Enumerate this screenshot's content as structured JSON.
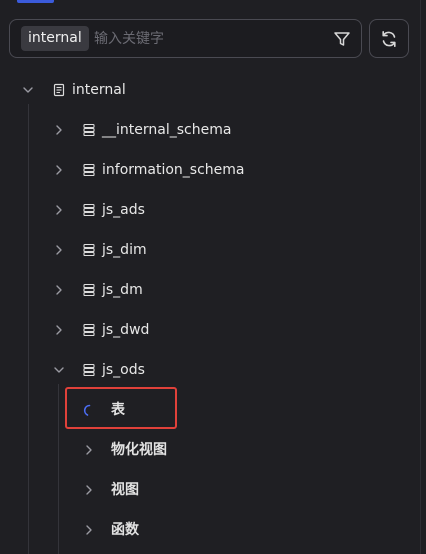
{
  "search": {
    "catalog": "internal",
    "placeholder": "输入关键字"
  },
  "tree": {
    "root": {
      "label": "internal",
      "expanded": true
    },
    "databases": [
      {
        "label": "__internal_schema",
        "expanded": false
      },
      {
        "label": "information_schema",
        "expanded": false
      },
      {
        "label": "js_ads",
        "expanded": false
      },
      {
        "label": "js_dim",
        "expanded": false
      },
      {
        "label": "js_dm",
        "expanded": false
      },
      {
        "label": "js_dwd",
        "expanded": false
      },
      {
        "label": "js_ods",
        "expanded": true
      }
    ],
    "js_ods_children": [
      {
        "label": "表",
        "state": "loading"
      },
      {
        "label": "物化视图",
        "state": "collapsed"
      },
      {
        "label": "视图",
        "state": "collapsed"
      },
      {
        "label": "函数",
        "state": "collapsed"
      }
    ]
  },
  "colors": {
    "background": "#1f1f23",
    "accent": "#3b5bdb",
    "highlight_border": "#e0413a",
    "text": "#e8e8e8",
    "placeholder": "#6b6b73"
  },
  "icons": {
    "filter": "filter-icon",
    "refresh": "refresh-icon",
    "catalog": "document-icon",
    "database": "database-icon",
    "expand": "chevron-right-icon",
    "collapse": "chevron-down-icon",
    "loading": "spinner-icon"
  }
}
